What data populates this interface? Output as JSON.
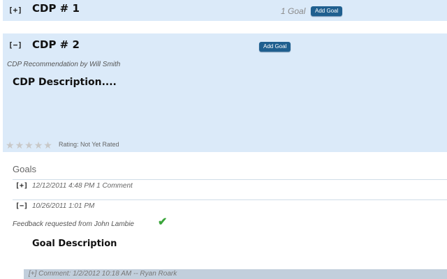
{
  "cdps": [
    {
      "toggle": "[+]",
      "title": "CDP # 1",
      "goal_count": "1 Goal",
      "add_goal_label": "Add Goal"
    },
    {
      "toggle": "[−]",
      "title": "CDP # 2",
      "add_goal_label": "Add Goal",
      "recommendation": "CDP Recommendation by Will Smith",
      "description": "CDP Description....",
      "rating": {
        "stars_total": 5,
        "stars_filled": 0,
        "label": "Rating: Not Yet Rated"
      }
    }
  ],
  "goals": {
    "header": "Goals",
    "items": [
      {
        "toggle": "[+]",
        "meta": "12/12/2011 4:48 PM  1 Comment"
      },
      {
        "toggle": "[−]",
        "meta": "10/26/2011 1:01 PM",
        "feedback": "Feedback requested from John Lambie",
        "description": "Goal Description",
        "comment": "[+]  Comment: 1/2/2012 10:18 AM -- Ryan Roark"
      }
    ]
  },
  "icons": {
    "check": "check-icon",
    "star": "star-icon"
  },
  "colors": {
    "panel_bg": "#dbeaf9",
    "button_bg": "#1f5f8f",
    "check": "#3aa53a"
  }
}
